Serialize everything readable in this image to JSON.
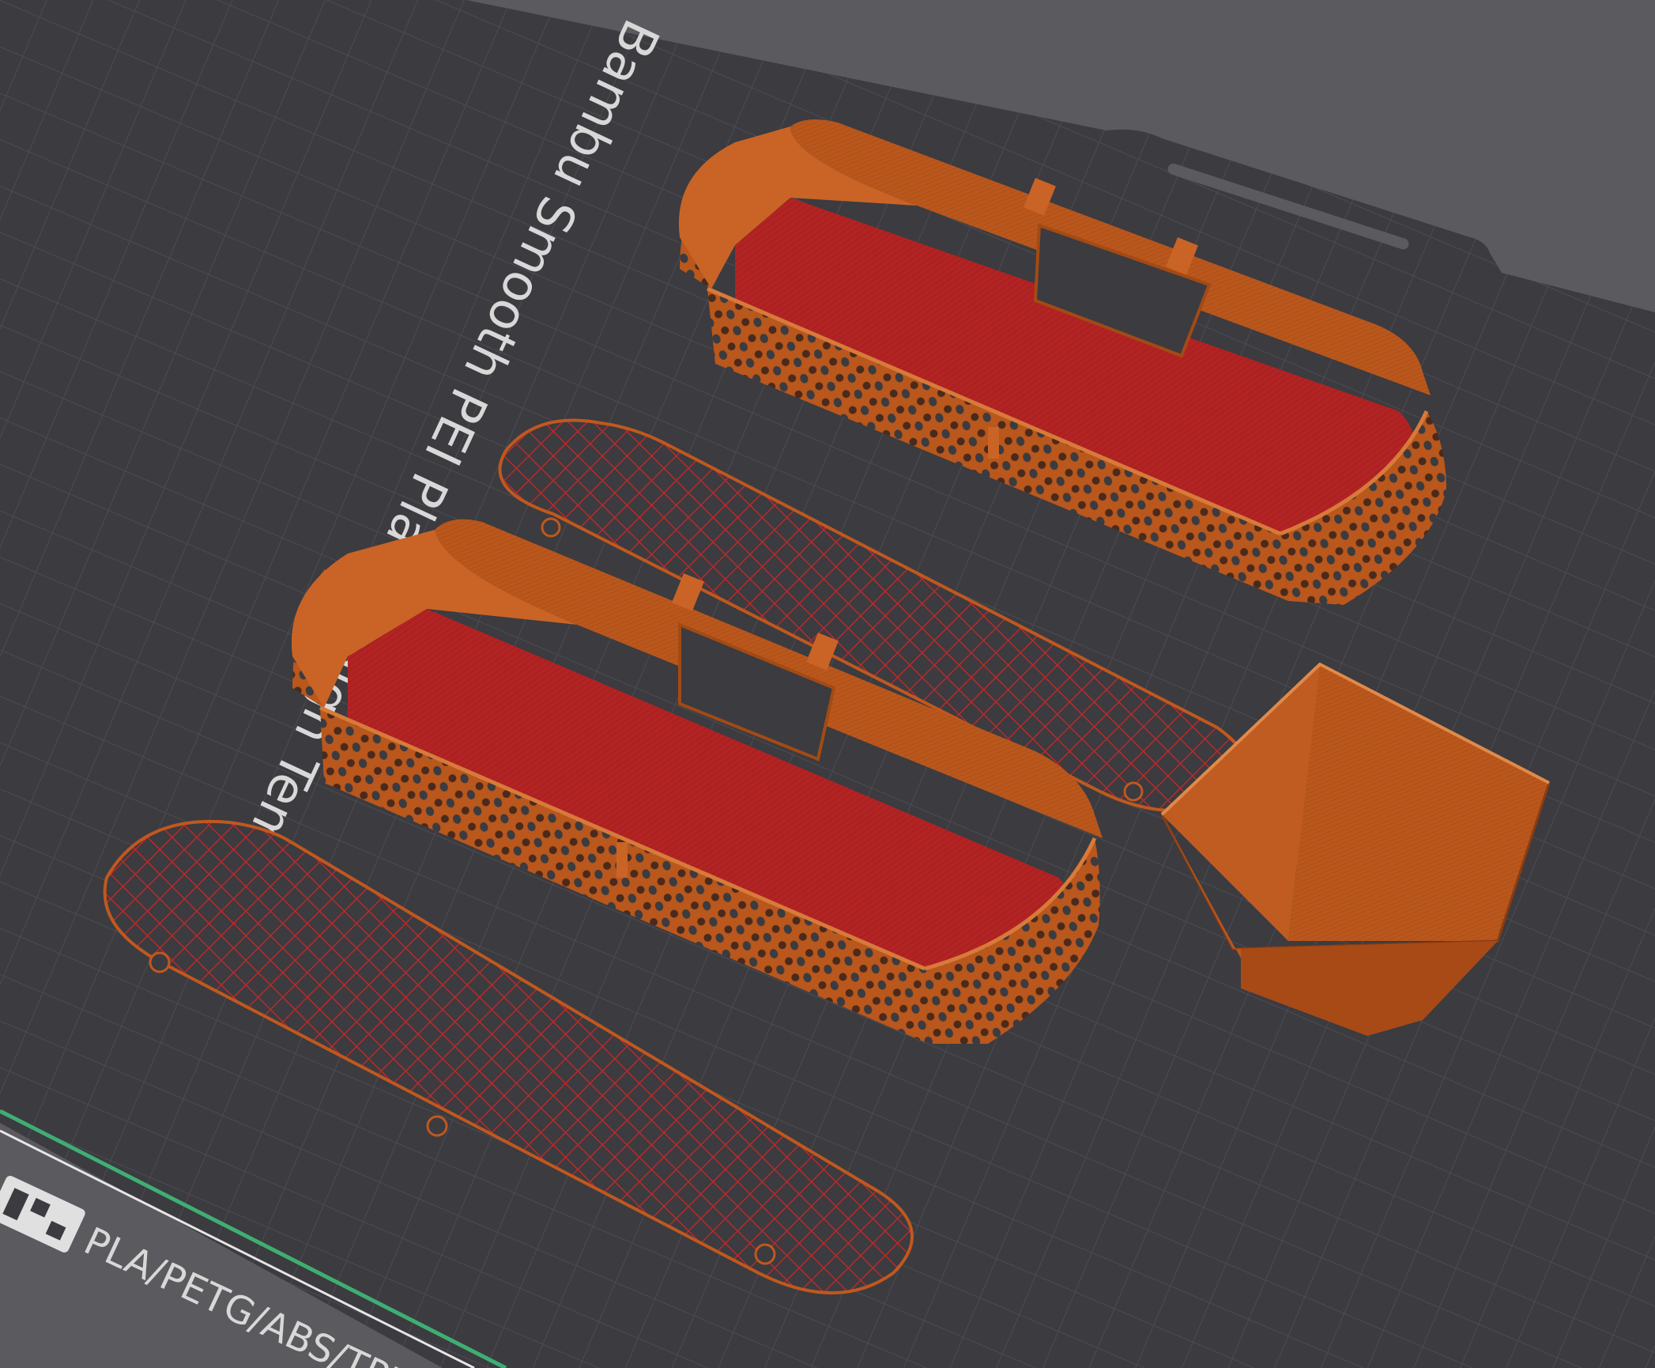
{
  "plate": {
    "title": "Bambu Smooth PEI Plate / High Temp",
    "materials": "PLA/PETG/ABS/TPU",
    "logo_icon": "bambu-logo-icon"
  },
  "colors": {
    "background": "#5b5b5f",
    "plate": "#3b3b40",
    "grid": "#4a4a50",
    "label_text": "#d8d8d8",
    "part_wall": "#b8561c",
    "part_wall_light": "#cd6a2a",
    "part_wall_dark": "#8a3c12",
    "part_floor": "#b32222",
    "accent_green": "#3fae72"
  },
  "objects": [
    {
      "name": "enclosure-shell-upper"
    },
    {
      "name": "enclosure-shell-lower"
    },
    {
      "name": "mesh-lid-upper"
    },
    {
      "name": "mesh-lid-lower"
    },
    {
      "name": "funnel-hopper"
    }
  ]
}
